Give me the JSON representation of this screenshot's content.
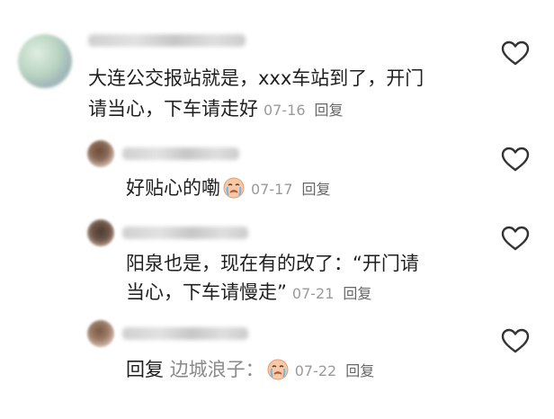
{
  "comments": [
    {
      "line1": "大连公交报站就是，xxx车站到了，开门",
      "line2_text": "请当心，下车请走好",
      "date": "07-16",
      "reply_label": "回复"
    },
    {
      "text": "好贴心的嘞",
      "emoji": "crying-face",
      "date": "07-17",
      "reply_label": "回复"
    },
    {
      "line1": "阳泉也是，现在有的改了：“开门请",
      "line2_text": "当心，下车请慢走”",
      "date": "07-21",
      "reply_label": "回复"
    },
    {
      "reply_prefix": "回复",
      "reply_to": "边城浪子：",
      "emoji": "crying-face",
      "date": "07-22",
      "reply_label": "回复"
    }
  ],
  "icons": {
    "like": "heart-outline-icon"
  },
  "colors": {
    "text": "#1f1f1f",
    "meta": "#9a9a9a",
    "reply": "#666666",
    "heart_stroke": "#333333"
  }
}
